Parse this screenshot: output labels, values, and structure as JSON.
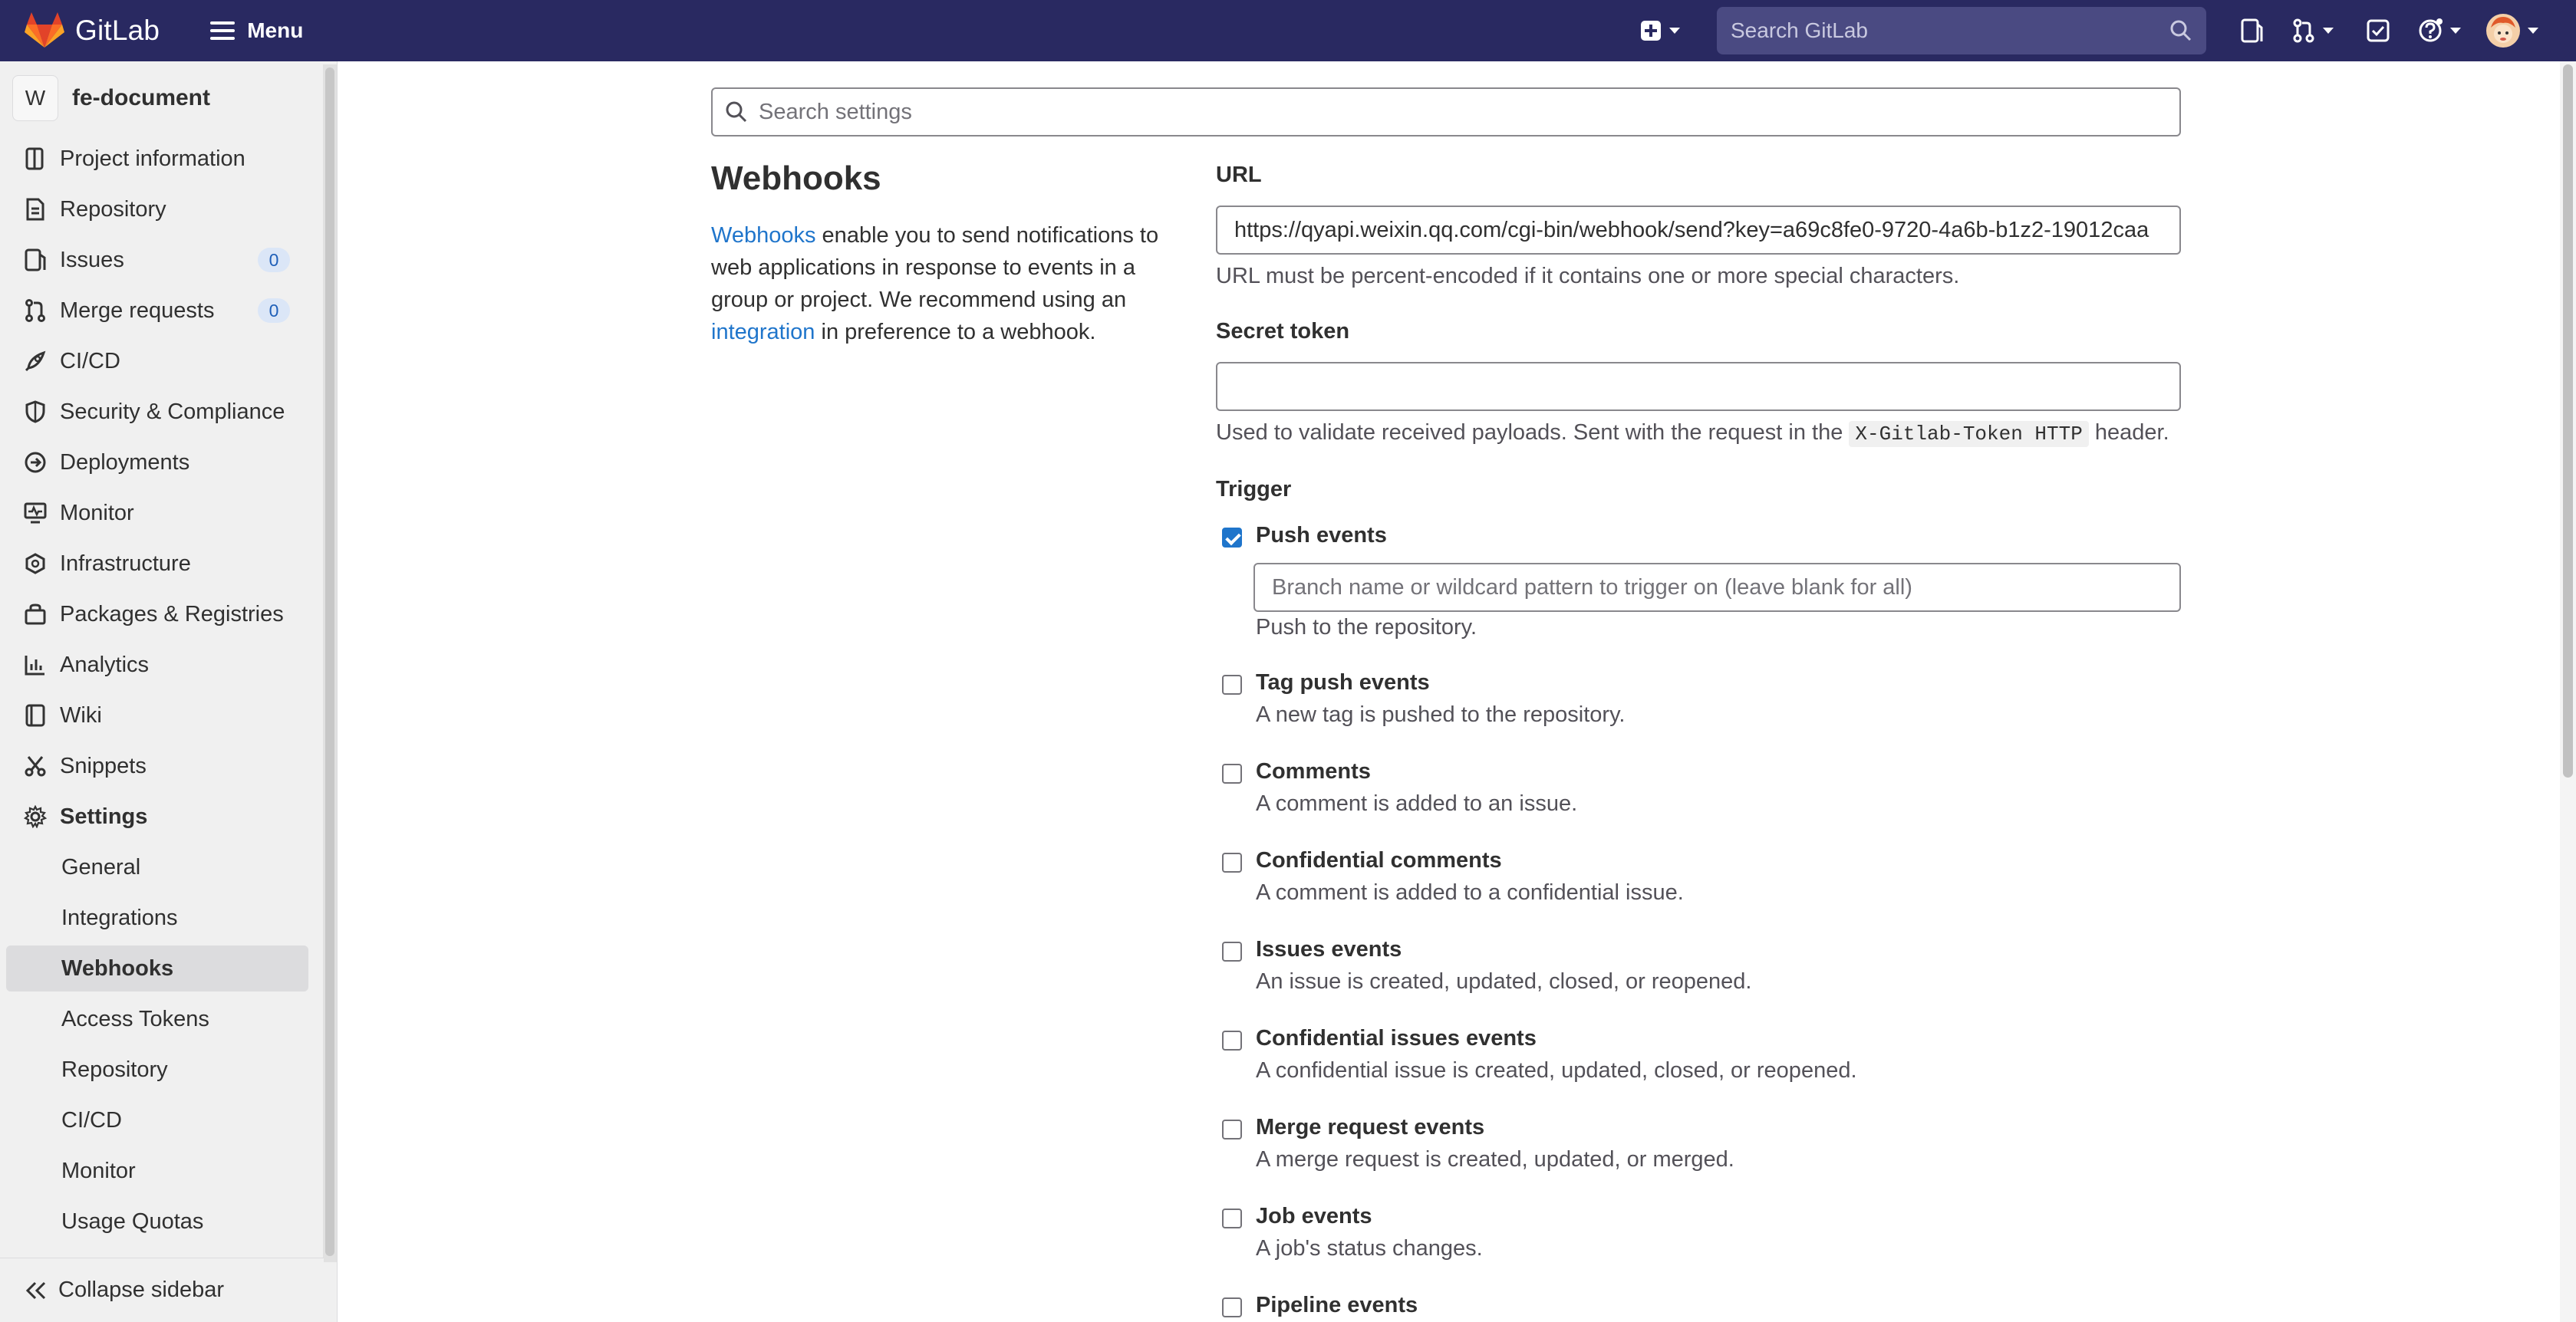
{
  "topbar": {
    "brand_name": "GitLab",
    "menu_label": "Menu",
    "search_placeholder": "Search GitLab",
    "icons": [
      "new-item-icon",
      "search-icon",
      "issues-icon",
      "merge-requests-icon",
      "todos-icon",
      "help-icon",
      "avatar"
    ]
  },
  "sidebar": {
    "project_initial": "W",
    "project_name": "fe-document",
    "items": [
      {
        "label": "Project information",
        "icon": "info-icon"
      },
      {
        "label": "Repository",
        "icon": "repository-icon"
      },
      {
        "label": "Issues",
        "icon": "issues-icon",
        "count": "0"
      },
      {
        "label": "Merge requests",
        "icon": "merge-request-icon",
        "count": "0"
      },
      {
        "label": "CI/CD",
        "icon": "rocket-icon"
      },
      {
        "label": "Security & Compliance",
        "icon": "shield-icon"
      },
      {
        "label": "Deployments",
        "icon": "deployments-icon"
      },
      {
        "label": "Monitor",
        "icon": "monitor-icon"
      },
      {
        "label": "Infrastructure",
        "icon": "cloud-icon"
      },
      {
        "label": "Packages & Registries",
        "icon": "package-icon"
      },
      {
        "label": "Analytics",
        "icon": "chart-icon"
      },
      {
        "label": "Wiki",
        "icon": "book-icon"
      },
      {
        "label": "Snippets",
        "icon": "snippet-icon"
      },
      {
        "label": "Settings",
        "icon": "gear-icon"
      }
    ],
    "settings_subitems": [
      "General",
      "Integrations",
      "Webhooks",
      "Access Tokens",
      "Repository",
      "CI/CD",
      "Monitor",
      "Usage Quotas"
    ],
    "active_subitem": "Webhooks",
    "collapse_label": "Collapse sidebar"
  },
  "main": {
    "settings_search_placeholder": "Search settings",
    "section_title": "Webhooks",
    "desc": {
      "link1": "Webhooks",
      "text1": " enable you to send notifications to web applications in response to events in a group or project. We recommend using an ",
      "link2": "integration",
      "text2": " in preference to a webhook."
    },
    "url_label": "URL",
    "url_value": "https://qyapi.weixin.qq.com/cgi-bin/webhook/send?key=a69c8fe0-9720-4a6b-b1z2-19012caa",
    "url_help": "URL must be percent-encoded if it contains one or more special characters.",
    "token_label": "Secret token",
    "token_value": "",
    "token_help_prefix": "Used to validate received payloads. Sent with the request in the ",
    "token_help_code": "X-Gitlab-Token HTTP",
    "token_help_suffix": " header.",
    "trigger_label": "Trigger",
    "branch_placeholder": "Branch name or wildcard pattern to trigger on (leave blank for all)",
    "triggers": [
      {
        "title": "Push events",
        "desc": "Push to the repository.",
        "checked": true
      },
      {
        "title": "Tag push events",
        "desc": "A new tag is pushed to the repository.",
        "checked": false
      },
      {
        "title": "Comments",
        "desc": "A comment is added to an issue.",
        "checked": false
      },
      {
        "title": "Confidential comments",
        "desc": "A comment is added to a confidential issue.",
        "checked": false
      },
      {
        "title": "Issues events",
        "desc": "An issue is created, updated, closed, or reopened.",
        "checked": false
      },
      {
        "title": "Confidential issues events",
        "desc": "A confidential issue is created, updated, closed, or reopened.",
        "checked": false
      },
      {
        "title": "Merge request events",
        "desc": "A merge request is created, updated, or merged.",
        "checked": false
      },
      {
        "title": "Job events",
        "desc": "A job's status changes.",
        "checked": false
      },
      {
        "title": "Pipeline events",
        "desc": "",
        "checked": false
      }
    ]
  },
  "colors": {
    "navbar": "#292961",
    "link": "#1f75cb",
    "sidebar_bg": "#f0f0f0",
    "active_item": "#dcdcde"
  }
}
